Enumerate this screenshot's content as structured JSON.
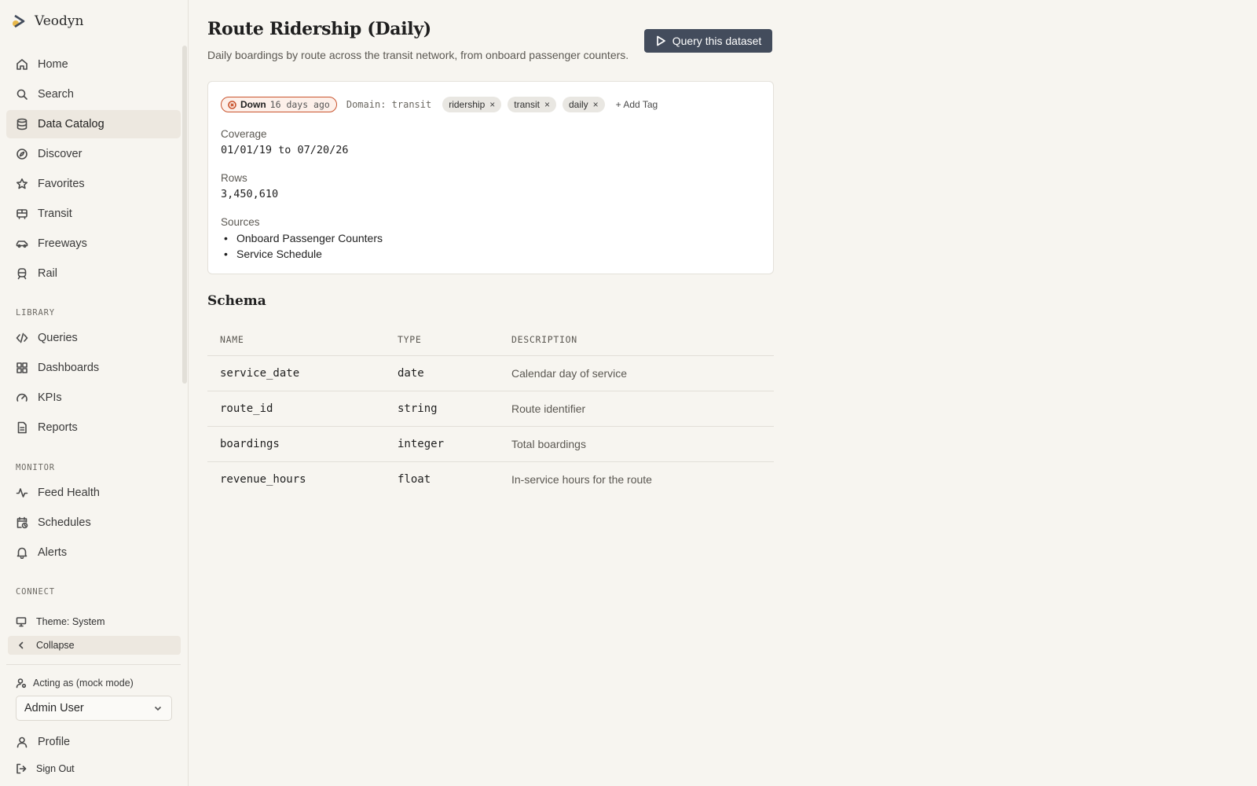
{
  "app": {
    "name": "Veodyn"
  },
  "sidebar": {
    "items": [
      {
        "label": "Home",
        "icon": "home-icon"
      },
      {
        "label": "Search",
        "icon": "search-icon"
      },
      {
        "label": "Data Catalog",
        "icon": "database-icon",
        "active": true
      },
      {
        "label": "Discover",
        "icon": "compass-icon"
      },
      {
        "label": "Favorites",
        "icon": "star-icon"
      },
      {
        "label": "Transit",
        "icon": "bus-icon"
      },
      {
        "label": "Freeways",
        "icon": "car-icon"
      },
      {
        "label": "Rail",
        "icon": "train-icon"
      }
    ],
    "library_label": "LIBRARY",
    "library": [
      {
        "label": "Queries",
        "icon": "code-icon"
      },
      {
        "label": "Dashboards",
        "icon": "dashboard-icon"
      },
      {
        "label": "KPIs",
        "icon": "gauge-icon"
      },
      {
        "label": "Reports",
        "icon": "file-icon"
      }
    ],
    "monitor_label": "MONITOR",
    "monitor": [
      {
        "label": "Feed Health",
        "icon": "activity-icon"
      },
      {
        "label": "Schedules",
        "icon": "calendar-clock-icon"
      },
      {
        "label": "Alerts",
        "icon": "bell-icon"
      }
    ],
    "connect_label": "CONNECT",
    "theme_label": "Theme: System",
    "collapse_label": "Collapse",
    "acting_label": "Acting as (mock mode)",
    "acting_user": "Admin User",
    "profile_label": "Profile",
    "signout_label": "Sign Out"
  },
  "page": {
    "title": "Route Ridership (Daily)",
    "description": "Daily boardings by route across the transit network, from onboard passenger counters.",
    "query_button": "Query this dataset"
  },
  "card": {
    "status": "Down",
    "status_age": "16 days ago",
    "status_color": "#c9542e",
    "domain": "Domain: transit",
    "tags": [
      "ridership",
      "transit",
      "daily"
    ],
    "tag_remove": "×",
    "add_tag": "+ Add Tag",
    "coverage_label": "Coverage",
    "coverage_value": "01/01/19 to 07/20/26",
    "rows_label": "Rows",
    "rows_value": "3,450,610",
    "sources_label": "Sources",
    "sources": [
      "Onboard Passenger Counters",
      "Service Schedule"
    ]
  },
  "schema": {
    "title": "Schema",
    "headers": [
      "NAME",
      "TYPE",
      "DESCRIPTION"
    ],
    "rows": [
      {
        "name": "service_date",
        "type": "date",
        "description": "Calendar day of service"
      },
      {
        "name": "route_id",
        "type": "string",
        "description": "Route identifier"
      },
      {
        "name": "boardings",
        "type": "integer",
        "description": "Total boardings"
      },
      {
        "name": "revenue_hours",
        "type": "float",
        "description": "In-service hours for the route"
      }
    ]
  }
}
